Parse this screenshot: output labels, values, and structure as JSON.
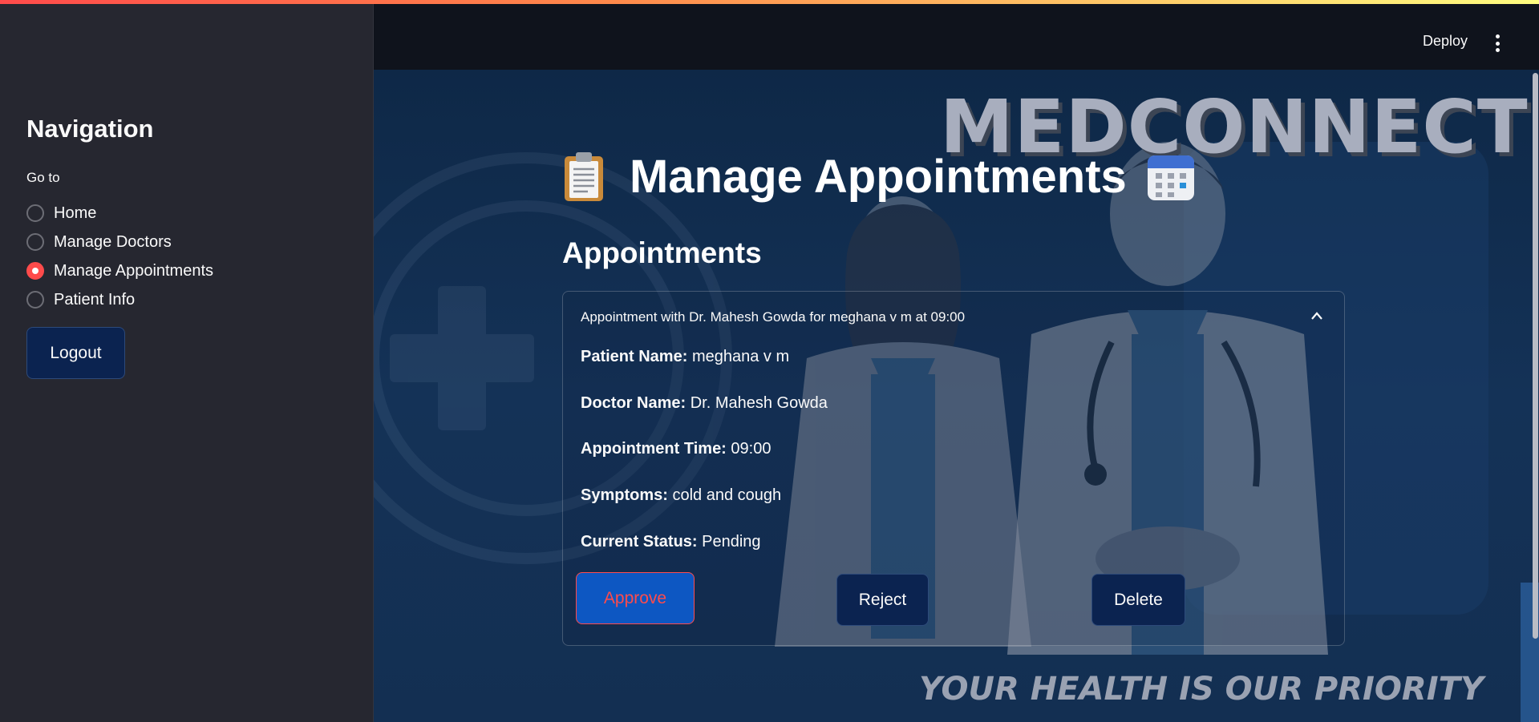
{
  "sidebar": {
    "title": "Navigation",
    "radio_label": "Go to",
    "items": [
      {
        "label": "Home",
        "selected": false
      },
      {
        "label": "Manage Doctors",
        "selected": false
      },
      {
        "label": "Manage Appointments",
        "selected": true
      },
      {
        "label": "Patient Info",
        "selected": false
      }
    ],
    "logout_label": "Logout"
  },
  "header": {
    "deploy_label": "Deploy",
    "menu_icon": "more-vertical-icon"
  },
  "background": {
    "brand_text": "MEDCONNECT",
    "tagline": "YOUR HEALTH IS OUR PRIORITY"
  },
  "main": {
    "title": "Manage Appointments",
    "title_icon_left": "clipboard-icon",
    "title_icon_right": "calendar-icon",
    "section_title": "Appointments",
    "appointment": {
      "header": "Appointment with Dr. Mahesh Gowda for meghana v m at 09:00",
      "expanded": true,
      "fields": [
        {
          "label": "Patient Name:",
          "value": "meghana v m"
        },
        {
          "label": "Doctor Name:",
          "value": "Dr. Mahesh Gowda"
        },
        {
          "label": "Appointment Time:",
          "value": "09:00"
        },
        {
          "label": "Symptoms:",
          "value": "cold and cough"
        },
        {
          "label": "Current Status:",
          "value": "Pending"
        }
      ],
      "approve_label": "Approve",
      "reject_label": "Reject",
      "delete_label": "Delete"
    }
  },
  "colors": {
    "accent": "#ff4b4b",
    "sidebar_bg": "#262730",
    "main_bg": "#0e2847",
    "button_bg": "#0b2350",
    "approve_bg": "#0d57c2"
  }
}
